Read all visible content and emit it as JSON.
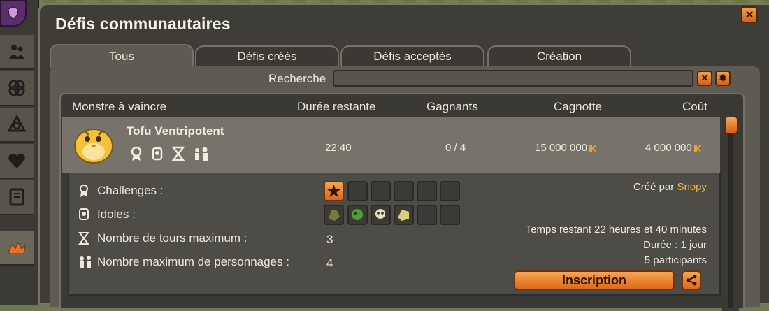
{
  "window": {
    "title": "Défis communautaires"
  },
  "tabs": [
    {
      "label": "Tous",
      "active": true
    },
    {
      "label": "Défis créés",
      "active": false
    },
    {
      "label": "Défis acceptés",
      "active": false
    },
    {
      "label": "Création",
      "active": false
    }
  ],
  "search": {
    "label": "Recherche",
    "value": "",
    "placeholder": ""
  },
  "table": {
    "headers": {
      "monster": "Monstre à vaincre",
      "duration": "Durée restante",
      "winners": "Gagnants",
      "pot": "Cagnotte",
      "cost": "Coût"
    },
    "rows": [
      {
        "monster": "Tofu Ventripotent",
        "duration": "22:40",
        "winners": "0 / 4",
        "pot": "15 000 000",
        "cost": "4 000 000"
      }
    ]
  },
  "details": {
    "challenges_label": "Challenges :",
    "idols_label": "Idoles :",
    "max_turns_label": "Nombre de tours maximum :",
    "max_turns_value": "3",
    "max_chars_label": "Nombre maximum de personnages :",
    "max_chars_value": "4",
    "created_by": "Créé par",
    "creator": "Snopy",
    "time_left": "Temps restant 22 heures et 40 minutes",
    "duration": "Durée : 1 jour",
    "participants": "5 participants",
    "register_label": "Inscription"
  },
  "colors": {
    "accent": "#e06818",
    "creator": "#f0b64a",
    "panel": "#3e3d38"
  },
  "icons": [
    "close-icon",
    "settings-icon",
    "challenge-icon",
    "idol-icon",
    "hourglass-icon",
    "group-icon",
    "kama-icon",
    "share-icon"
  ]
}
